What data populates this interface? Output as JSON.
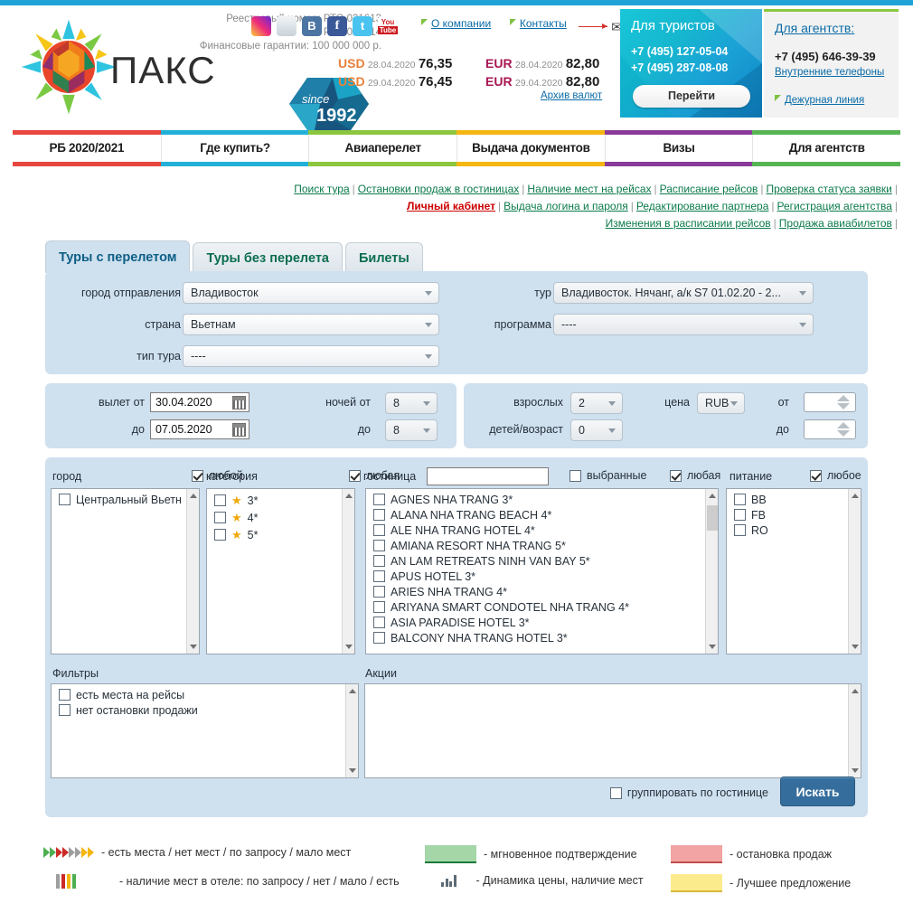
{
  "header": {
    "registry_line1": "Реестровый номер: РТО 021613",
    "registry_line2": "РТО 021614",
    "guarantees": "Финансовые гарантии: 100 000 000 р.",
    "brand": "ПАКС",
    "since": "since",
    "since_year": "1992",
    "social": [
      "instagram-icon",
      "livejournal-icon",
      "vk-icon",
      "facebook-icon",
      "twitter-icon",
      "youtube-icon"
    ],
    "about_link": "О компании",
    "contacts_link": "Контакты",
    "currency": [
      {
        "code": "USD",
        "date": "28.04.2020",
        "value": "76,35"
      },
      {
        "code": "USD",
        "date": "29.04.2020",
        "value": "76,45"
      },
      {
        "code": "EUR",
        "date": "28.04.2020",
        "value": "82,80"
      },
      {
        "code": "EUR",
        "date": "29.04.2020",
        "value": "82,80"
      }
    ],
    "currency_archive": "Архив валют",
    "tourists": {
      "title": "Для туристов",
      "phone1": "+7 (495) 127-05-04",
      "phone2": "+7 (495) 287-08-08",
      "button": "Перейти"
    },
    "agents": {
      "title": "Для агентств:",
      "phone": "+7 (495) 646-39-39",
      "internal": "Внутренние телефоны",
      "duty": "Дежурная линия"
    }
  },
  "nav": [
    {
      "label": "РБ 2020/2021",
      "color": "#e8473f"
    },
    {
      "label": "Где купить?",
      "color": "#23b0d8"
    },
    {
      "label": "Авиаперелет",
      "color": "#8cc63e"
    },
    {
      "label": "Выдача документов",
      "color": "#f5b611"
    },
    {
      "label": "Визы",
      "color": "#8a3a9a"
    },
    {
      "label": "Для агентств",
      "color": "#57b453"
    }
  ],
  "quicklinks": {
    "row1": [
      "Поиск тура",
      "Остановки продаж в гостиницах",
      "Наличие мест на рейсах",
      "Расписание рейсов",
      "Проверка статуса заявки"
    ],
    "row2": [
      "Личный кабинет",
      "Выдача логина и пароля",
      "Редактирование партнера",
      "Регистрация агентства"
    ],
    "row3": [
      "Изменения в расписании рейсов",
      "Продажа авиабилетов"
    ],
    "active": "Личный кабинет"
  },
  "tabs": [
    {
      "label": "Туры с перелетом",
      "active": true
    },
    {
      "label": "Туры без перелета",
      "active": false
    },
    {
      "label": "Билеты",
      "active": false
    }
  ],
  "form": {
    "departure_city_label": "город отправления",
    "departure_city_value": "Владивосток",
    "country_label": "страна",
    "country_value": "Вьетнам",
    "tour_type_label": "тип тура",
    "tour_type_value": "----",
    "tour_label": "тур",
    "tour_value": "Владивосток. Нячанг, а/к S7 01.02.20 - 2...",
    "program_label": "программа",
    "program_value": "----",
    "departure_from_label": "вылет от",
    "departure_from_value": "30.04.2020",
    "departure_to_label": "до",
    "departure_to_value": "07.05.2020",
    "nights_from_label": "ночей от",
    "nights_from_value": "8",
    "nights_to_label": "до",
    "nights_to_value": "8",
    "adults_label": "взрослых",
    "adults_value": "2",
    "children_label": "детей/возраст",
    "children_value": "0",
    "price_label": "цена",
    "currency_value": "RUB",
    "price_from_label": "от",
    "price_from_value": "",
    "price_to_label": "до",
    "price_to_value": ""
  },
  "filters": {
    "city": {
      "label": "город",
      "any_label": "любой",
      "any_checked": true,
      "items": [
        "Центральный Вьетн"
      ]
    },
    "category": {
      "label": "категория",
      "any_label": "любая",
      "any_checked": true,
      "items": [
        "3*",
        "4*",
        "5*"
      ]
    },
    "hotel": {
      "label": "гостиница",
      "search_value": "",
      "selected_label": "выбранные",
      "selected_checked": false,
      "any_label": "любая",
      "any_checked": true,
      "items": [
        "AGNES NHA TRANG 3*",
        "ALANA NHA TRANG BEACH 4*",
        "ALE NHA TRANG HOTEL 4*",
        "AMIANA RESORT NHA TRANG 5*",
        "AN LAM RETREATS NINH VAN BAY 5*",
        "APUS HOTEL 3*",
        "ARIES NHA TRANG 4*",
        "ARIYANA SMART CONDOTEL NHA TRANG 4*",
        "ASIA PARADISE HOTEL 3*",
        "BALCONY NHA TRANG HOTEL 3*"
      ]
    },
    "meal": {
      "label": "питание",
      "any_label": "любое",
      "any_checked": true,
      "items": [
        "BB",
        "FB",
        "RO"
      ]
    },
    "filters_box": {
      "label": "Фильтры",
      "items": [
        "есть места на рейсы",
        "нет остановки продажи"
      ]
    },
    "promo_box": {
      "label": "Акции",
      "items": []
    }
  },
  "actions": {
    "group_by_hotel_label": "группировать по гостинице",
    "group_by_hotel_checked": false,
    "search_button": "Искать"
  },
  "legend": [
    {
      "icon": "chevrons",
      "text": "- есть места / нет мест / по запросу / мало мест",
      "colors": [
        "#4caf50",
        "#4caf50",
        "#cc2a26",
        "#cc2a26",
        "#9e9e9e",
        "#9e9e9e",
        "#f5b611",
        "#f5b611"
      ]
    },
    {
      "icon": "bars",
      "text": "- наличие мест в отеле: по запросу / нет / мало / есть",
      "colors": [
        "#9e9e9e",
        "#cc2a26",
        "#f5b611",
        "#4caf50"
      ]
    },
    {
      "icon": "swatch-green",
      "text": "- мгновенное подтверждение",
      "color": "#a5d6a7"
    },
    {
      "icon": "minichart",
      "text": "- Динамика цены, наличие мест",
      "color": "#5b6b76"
    },
    {
      "icon": "swatch-red",
      "text": "- остановка продаж",
      "color": "#f2a3a3"
    },
    {
      "icon": "swatch-yellow",
      "text": "- Лучшее предложение",
      "color": "#fceb8c"
    }
  ]
}
